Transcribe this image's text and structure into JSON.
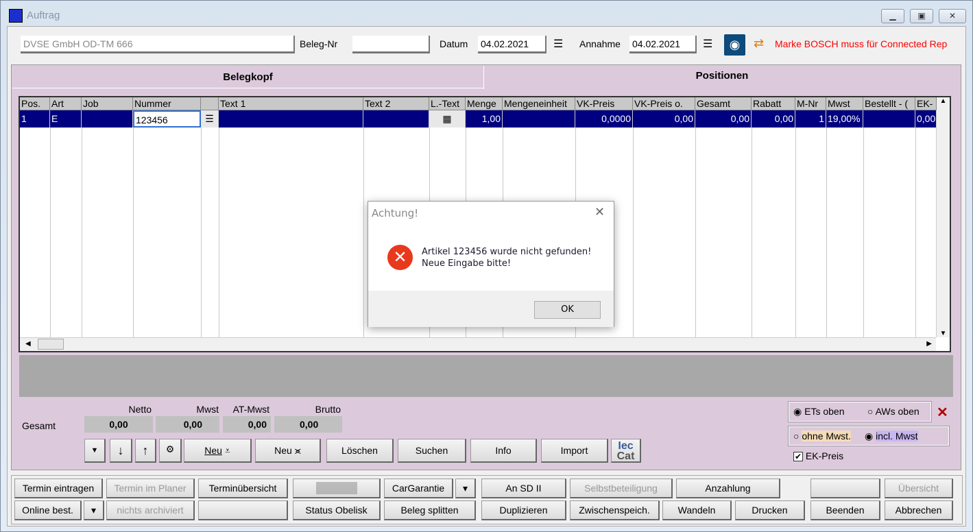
{
  "window": {
    "title": "Auftrag",
    "controls": [
      "minimize",
      "maximize",
      "close"
    ]
  },
  "header": {
    "customer": "DVSE GmbH OD-TM 666",
    "beleg_nr_label": "Beleg-Nr",
    "beleg_nr": "",
    "datum_label": "Datum",
    "datum": "04.02.2021",
    "annahme_label": "Annahme",
    "annahme": "04.02.2021",
    "notice": "Marke BOSCH muss für Connected Rep",
    "notice_color": "#ff0000"
  },
  "tabs": [
    {
      "label": "Belegkopf",
      "selected": false
    },
    {
      "label": "Positionen",
      "selected": true
    }
  ],
  "grid": {
    "columns": [
      "Pos.",
      "Art",
      "Job",
      "Nummer",
      "",
      "Text 1",
      "Text 2",
      "L.-Text",
      "Menge",
      "Mengeneinheit",
      "VK-Preis",
      "VK-Preis o.",
      "Gesamt",
      "Rabatt",
      "M-Nr",
      "Mwst",
      "Bestellt - (",
      "EK-"
    ],
    "rows": [
      [
        "1",
        "E",
        "",
        "123456",
        "",
        "",
        "",
        "",
        "1,00",
        "",
        "0,0000",
        "0,00",
        "0,00",
        "0,00",
        "1",
        "19,00%",
        "",
        "0,00"
      ]
    ],
    "selected_color": "#000080"
  },
  "totals": {
    "label": "Gesamt",
    "netto_label": "Netto",
    "netto": "0,00",
    "mwst_label": "Mwst",
    "mwst": "0,00",
    "atmwst_label": "AT-Mwst",
    "atmwst": "0,00",
    "brutto_label": "Brutto",
    "brutto": "0,00"
  },
  "toolbar": {
    "neu1": "Neu",
    "neu2": "Neu",
    "loeschen": "Löschen",
    "suchen": "Suchen",
    "info": "Info",
    "import": "Import",
    "ieccat_logo": "IecCat"
  },
  "options": {
    "ets_oben": "ETs oben",
    "aws_oben": "AWs oben",
    "sort_selected": "ETs oben",
    "ohne_mwst": "ohne Mwst.",
    "incl_mwst": "incl. Mwst",
    "mwst_selected": "incl. Mwst",
    "ek_preis": "EK-Preis",
    "ek_preis_checked": true
  },
  "bottom": {
    "row1": [
      {
        "label": "Termin eintragen"
      },
      {
        "label": "Termin im Planer",
        "disabled": true
      },
      {
        "label": "Terminübersicht"
      },
      {
        "label": ""
      },
      {
        "label": "CarGarantie"
      },
      {
        "label": "▾"
      },
      {
        "label": "An SD II"
      },
      {
        "label": "Selbstbeteiligung",
        "disabled": true
      },
      {
        "label": "Anzahlung"
      },
      {
        "label": ""
      },
      {
        "label": "Übersicht",
        "disabled": true
      }
    ],
    "row2": [
      {
        "label": "Online best."
      },
      {
        "label": "▾"
      },
      {
        "label": "nichts archiviert",
        "disabled": true
      },
      {
        "label": ""
      },
      {
        "label": "Status Obelisk"
      },
      {
        "label": "Beleg splitten"
      },
      {
        "label": "Duplizieren"
      },
      {
        "label": "Zwischenspeich."
      },
      {
        "label": "Wandeln"
      },
      {
        "label": "Drucken"
      },
      {
        "label": "Beenden"
      },
      {
        "label": "Abbrechen"
      }
    ]
  },
  "dialog": {
    "title": "Achtung!",
    "line1": "Artikel 123456 wurde nicht gefunden!",
    "line2": "Neue Eingabe bitte!",
    "ok": "OK",
    "icon": "error-icon"
  }
}
